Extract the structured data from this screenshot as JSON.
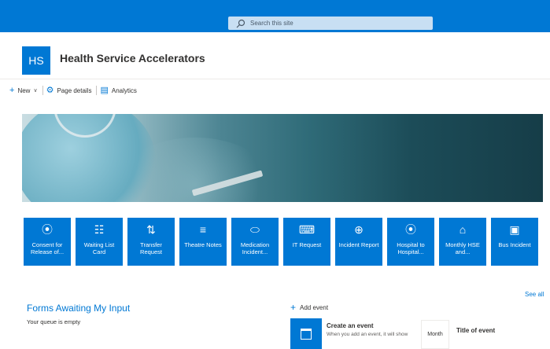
{
  "search": {
    "placeholder": "Search this site"
  },
  "site": {
    "logo_initials": "HS",
    "title": "Health Service Accelerators"
  },
  "commands": {
    "new_label": "New",
    "page_details_label": "Page details",
    "analytics_label": "Analytics"
  },
  "tiles": [
    {
      "icon": "person-icon",
      "glyph": "⦿",
      "label": "Consent for Release of..."
    },
    {
      "icon": "checklist-icon",
      "glyph": "☷",
      "label": "Waiting List Card"
    },
    {
      "icon": "transfer-arrows-icon",
      "glyph": "⇅",
      "label": "Transfer Request"
    },
    {
      "icon": "notes-list-icon",
      "glyph": "≡",
      "label": "Theatre Notes"
    },
    {
      "icon": "pill-icon",
      "glyph": "⬭",
      "label": "Medication Incident..."
    },
    {
      "icon": "keyboard-icon",
      "glyph": "⌨",
      "label": "IT Request"
    },
    {
      "icon": "globe-icon",
      "glyph": "⊕",
      "label": "Incident Report"
    },
    {
      "icon": "person-icon",
      "glyph": "⦿",
      "label": "Hospital to Hospital..."
    },
    {
      "icon": "home-icon",
      "glyph": "⌂",
      "label": "Monthly HSE and..."
    },
    {
      "icon": "bus-icon",
      "glyph": "▣",
      "label": "Bus Incident"
    }
  ],
  "see_all": "See all",
  "forms": {
    "title": "Forms Awaiting My Input",
    "empty_text": "Your queue is empty"
  },
  "events": {
    "add_label": "Add event",
    "create_title": "Create an event",
    "create_desc": "When you add an event, it will show",
    "month_label": "Month",
    "title_of_event": "Title of event"
  },
  "colors": {
    "accent": "#0078d4",
    "suite_bar": "#0078d4"
  }
}
